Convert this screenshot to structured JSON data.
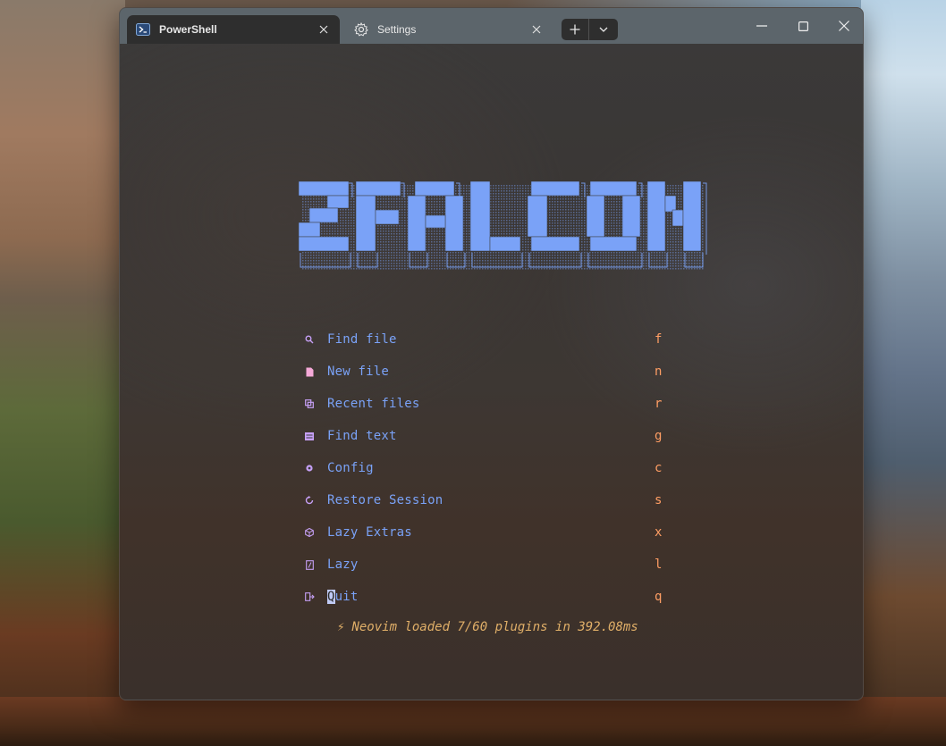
{
  "tabs": [
    {
      "label": "PowerShell",
      "icon": "powershell-icon",
      "active": true
    },
    {
      "label": "Settings",
      "icon": "gear-icon",
      "active": false
    }
  ],
  "window_controls": [
    "minimize-icon",
    "maximize-icon",
    "close-icon"
  ],
  "dashboard": {
    "logo_text": "ZFALCON",
    "items": [
      {
        "icon": "search-icon",
        "label": "Find file",
        "key": "f"
      },
      {
        "icon": "new-file-icon",
        "label": "New file",
        "key": "n"
      },
      {
        "icon": "recent-files-icon",
        "label": "Recent files",
        "key": "r"
      },
      {
        "icon": "find-text-icon",
        "label": "Find text",
        "key": "g"
      },
      {
        "icon": "config-gear-icon",
        "label": "Config",
        "key": "c"
      },
      {
        "icon": "restore-icon",
        "label": "Restore Session",
        "key": "s"
      },
      {
        "icon": "package-icon",
        "label": "Lazy Extras",
        "key": "x"
      },
      {
        "icon": "lazy-icon",
        "label": "Lazy",
        "key": "l"
      },
      {
        "icon": "quit-icon",
        "label_first": "Q",
        "label_rest": "uit",
        "key": "q"
      }
    ],
    "footer": {
      "bolt": "⚡",
      "text": "Neovim loaded 7/60 plugins in 392.08ms"
    }
  },
  "colors": {
    "label": "#7aa2f7",
    "key": "#ff9e64",
    "footer": "#e0af68",
    "logo_fill": "#7aa2f7",
    "icon": "#bb9af7"
  }
}
